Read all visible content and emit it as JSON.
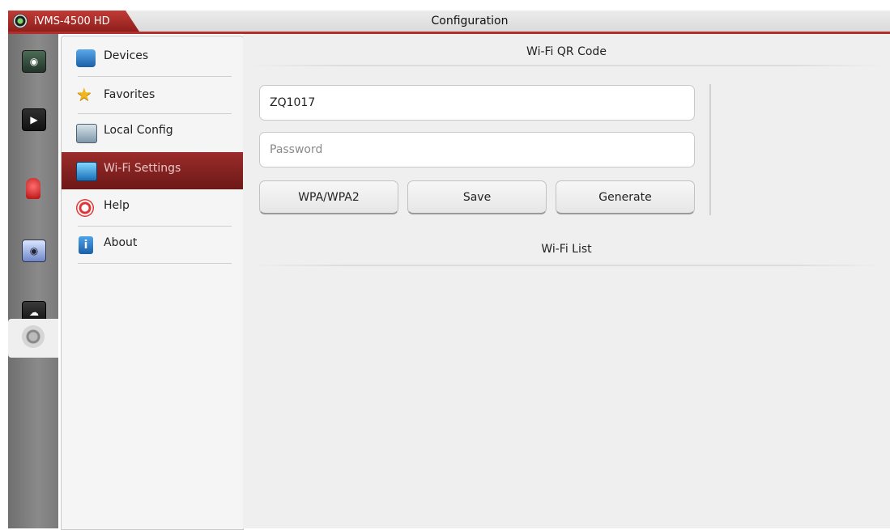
{
  "app": {
    "name": "iVMS-4500 HD",
    "window_title": "Configuration"
  },
  "rail": {
    "icons": [
      "live-view-icon",
      "playback-icon",
      "alarm-icon",
      "picture-icon",
      "cloud-icon",
      "configuration-icon"
    ],
    "active": "configuration-icon"
  },
  "menu": {
    "items": [
      {
        "label": "Devices",
        "icon": "devices-icon"
      },
      {
        "label": "Favorites",
        "icon": "star-icon"
      },
      {
        "label": "Local Config",
        "icon": "local-config-icon"
      },
      {
        "label": "Wi-Fi Settings",
        "icon": "wifi-settings-icon",
        "active": true
      },
      {
        "label": "Help",
        "icon": "help-icon"
      },
      {
        "label": "About",
        "icon": "info-icon"
      }
    ]
  },
  "wifi_qr": {
    "title": "Wi-Fi QR Code",
    "ssid_value": "ZQ1017",
    "password_placeholder": "Password",
    "security_label": "WPA/WPA2",
    "save_label": "Save",
    "generate_label": "Generate"
  },
  "wifi_list": {
    "title": "Wi-Fi List"
  },
  "colors": {
    "accent": "#9b2c2a",
    "title_bar": "#b1302d",
    "panel_bg": "#efefef"
  }
}
